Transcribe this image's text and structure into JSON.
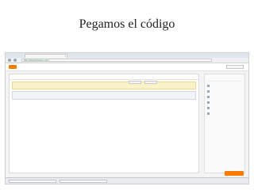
{
  "slide": {
    "title": "Pegamos el código"
  },
  "browser": {
    "tab": {
      "label": ""
    },
    "url": "http://www.blogger.com/"
  },
  "blogger": {
    "account_label": "",
    "editor_title": "",
    "notice_text": "",
    "notice2_text": "",
    "code_text": "",
    "sidebar_items": [
      {
        "icon": "settings-icon"
      },
      {
        "icon": "posts-icon"
      },
      {
        "icon": "pages-icon"
      },
      {
        "icon": "comments-icon"
      },
      {
        "icon": "layout-icon"
      },
      {
        "icon": "stats-icon"
      }
    ],
    "action_label": ""
  },
  "taskbar": {
    "items": [
      "",
      ""
    ]
  },
  "colors": {
    "accent": "#f57d00"
  }
}
